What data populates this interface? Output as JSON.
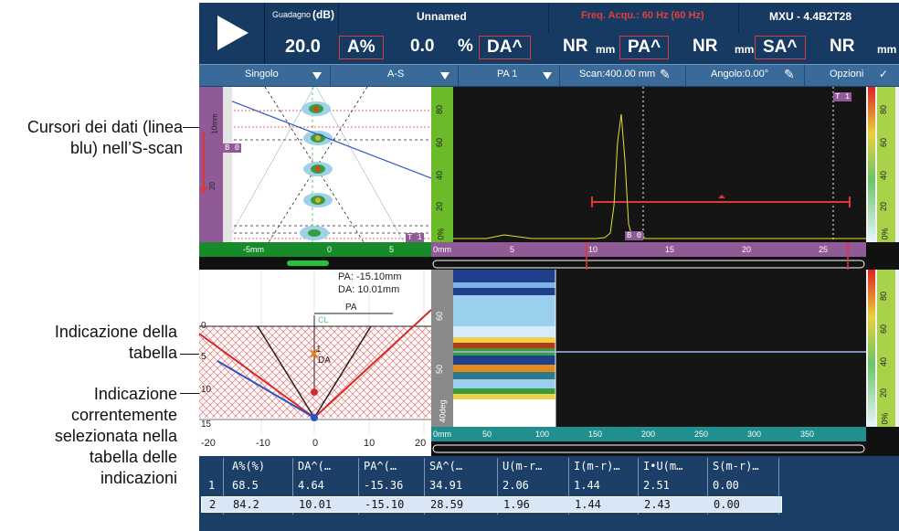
{
  "annotations": [
    {
      "lines": [
        "Cursori dei dati (linea",
        "blu) nell’S-scan"
      ]
    },
    {
      "lines": [
        "Indicazione della",
        "tabella"
      ]
    },
    {
      "lines": [
        "Indicazione",
        "correntemente",
        "selezionata nella",
        "tabella delle",
        "indicazioni"
      ]
    }
  ],
  "topbar": {
    "gain_label": "Guadagno",
    "gain_unit": "(dB)",
    "gain_value": "20.0",
    "title": "Unnamed",
    "freq": "Freq. Acqu.: 60 Hz (60 Hz)",
    "probe": "MXU - 4.4B2T28",
    "readings": [
      {
        "label": "A%",
        "value": "0.0",
        "unit": "%"
      },
      {
        "label": "DA^",
        "value": "NR",
        "unit": "mm"
      },
      {
        "label": "PA^",
        "value": "NR",
        "unit": "mm"
      },
      {
        "label": "SA^",
        "value": "NR",
        "unit": "mm"
      }
    ]
  },
  "menubar": [
    "Singolo",
    "A-S",
    "PA 1",
    "Scan:400.00 mm",
    "Angolo:0.00°",
    "Opzioni"
  ],
  "sscan": {
    "cursor_b0": "B 0",
    "cursor_t1": "T 1",
    "yticks": [
      "10mm",
      "20"
    ],
    "xticks": [
      "-5mm",
      "0",
      "5"
    ]
  },
  "ascan": {
    "yticks": [
      "80",
      "60",
      "40",
      "20",
      "0%"
    ],
    "xticks": [
      "0mm",
      "5",
      "10",
      "15",
      "20",
      "25"
    ],
    "t1": "T 1",
    "b0": "B 0",
    "right_ticks": [
      "80",
      "60",
      "40",
      "20",
      "0%"
    ]
  },
  "table_view": {
    "pa_readout": "PA: -15.10mm",
    "da_readout": "DA: 10.01mm",
    "pa_label": "PA",
    "cl_label": "CL",
    "da_label": "DA",
    "index_label": "1",
    "yticks": [
      "0",
      "5",
      "10",
      "15"
    ],
    "xticks": [
      "-20",
      "-10",
      "0",
      "10",
      "20"
    ]
  },
  "cscan": {
    "yticks": [
      "60",
      "50",
      "40deg"
    ],
    "xticks": [
      "0mm",
      "50",
      "100",
      "150",
      "200",
      "250",
      "300",
      "350"
    ],
    "right_ticks": [
      "80",
      "60",
      "40",
      "20",
      "0%"
    ]
  },
  "indications_table": {
    "headers": [
      "A%(%)",
      "DA^(…",
      "PA^(…",
      "SA^(…",
      "U(m-r…",
      "I(m-r)…",
      "I•U(m…",
      "S(m-r)…"
    ],
    "rows": [
      {
        "n": "1",
        "cells": [
          "68.5",
          "4.64",
          "-15.36",
          "34.91",
          "2.06",
          "1.44",
          "2.51",
          "0.00"
        ]
      },
      {
        "n": "2",
        "cells": [
          "84.2",
          "10.01",
          "-15.10",
          "28.59",
          "1.96",
          "1.44",
          "2.43",
          "0.00"
        ]
      }
    ]
  }
}
